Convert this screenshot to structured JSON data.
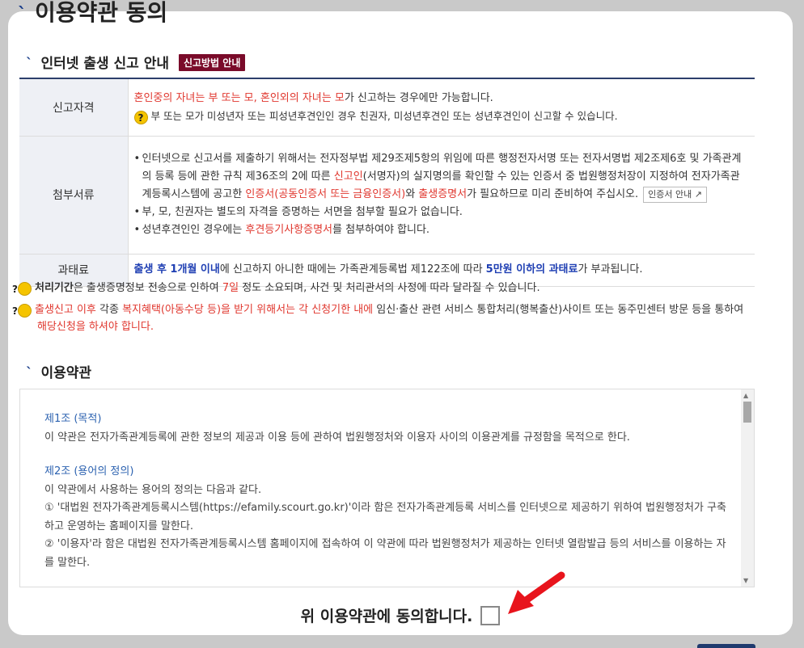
{
  "page_title": "이용약관 동의",
  "info_section": {
    "title": "인터넷 출생 신고 안내",
    "badge": "신고방법 안내"
  },
  "table": {
    "row1": {
      "label": "신고자격",
      "red_text": "혼인중의 자녀는 부 또는 모, 혼인외의 자녀는 모",
      "rest_text": "가 신고하는 경우에만 가능합니다.",
      "note": "부 또는 모가 미성년자 또는 피성년후견인인 경우 친권자, 미성년후견인 또는 성년후견인이 신고할 수 있습니다."
    },
    "row2": {
      "label": "첨부서류",
      "item1_a": "인터넷으로 신고서를 제출하기 위해서는 전자정부법 제29조제5항의 위임에 따른 행정전자서명 또는 전자서명법 제2조제6호 및 가족관계의 등록 등에 관한 규칙 제36조의 2에 따른 ",
      "item1_red1": "신고인",
      "item1_b": "(서명자)의 실지명의를 확인할 수 있는 인증서 중 법원행정처장이 지정하여 전자가족관계등록시스템에 공고한 ",
      "item1_red2": "인증서(공동인증서 또는 금융인증서)",
      "item1_c": "와 ",
      "item1_red3": "출생증명서",
      "item1_d": "가 필요하므로 미리 준비하여 주십시오.",
      "cert_button": "인증서 안내",
      "item2": "부, 모, 친권자는 별도의 자격을 증명하는 서면을 첨부할 필요가 없습니다.",
      "item3_a": "성년후견인인 경우에는 ",
      "item3_red": "후견등기사항증명서",
      "item3_b": "를 첨부하여야 합니다."
    },
    "row3": {
      "label": "과태료",
      "blue1": "출생 후 1개월 이내",
      "mid": "에 신고하지 아니한 때에는 가족관계등록법 제122조에 따라 ",
      "blue2": "5만원 이하의 과태료",
      "end": "가 부과됩니다."
    }
  },
  "notes": {
    "n1_bold": "처리기간",
    "n1_a": "은 출생증명정보 전송으로 인하여 ",
    "n1_red": "7일",
    "n1_b": " 정도 소요되며, 사건 및 처리관서의 사정에 따라 달라질 수 있습니다.",
    "n2_red1": "출생신고 이후",
    "n2_a": " 각종 ",
    "n2_red2": "복지혜택(아동수당 등)을 받기 위해서는 각 신청기한 내에",
    "n2_b": " 임신·출산 관련 서비스 통합처리(행복출산)사이트 또는 동주민센터 방문 등을 통하여 ",
    "n2_red3": "해당신청을 하셔야 합니다."
  },
  "terms_section": {
    "title": "이용약관",
    "article1_heading": "제1조 (목적)",
    "article1_body": "이 약관은 전자가족관계등록에 관한 정보의 제공과 이용 등에 관하여 법원행정처와 이용자 사이의 이용관계를 규정함을 목적으로 한다.",
    "article2_heading": "제2조 (용어의 정의)",
    "article2_intro": "이 약관에서 사용하는 용어의 정의는 다음과 같다.",
    "article2_item1": "① '대법원 전자가족관계등록시스템(https://efamily.scourt.go.kr)'이라 함은 전자가족관계등록 서비스를 인터넷으로 제공하기 위하여 법원행정처가 구축하고 운영하는 홈페이지를 말한다.",
    "article2_item2": "② '이용자'라 함은 대법원 전자가족관계등록시스템 홈페이지에 접속하여 이 약관에 따라 법원행정처가 제공하는 인터넷 열람발급 등의 서비스를 이용하는 자를 말한다."
  },
  "agree": {
    "label": "위 이용약관에 동의합니다.",
    "checked": false
  },
  "colors": {
    "accent_red": "#e0372e",
    "accent_blue": "#1f3fb3",
    "badge_bg": "#7a0b2a",
    "header_navy": "#2c3e6b",
    "arrow_red": "#e8141c"
  },
  "icons": [
    "question-icon",
    "external-link-icon",
    "red-arrow-icon"
  ]
}
